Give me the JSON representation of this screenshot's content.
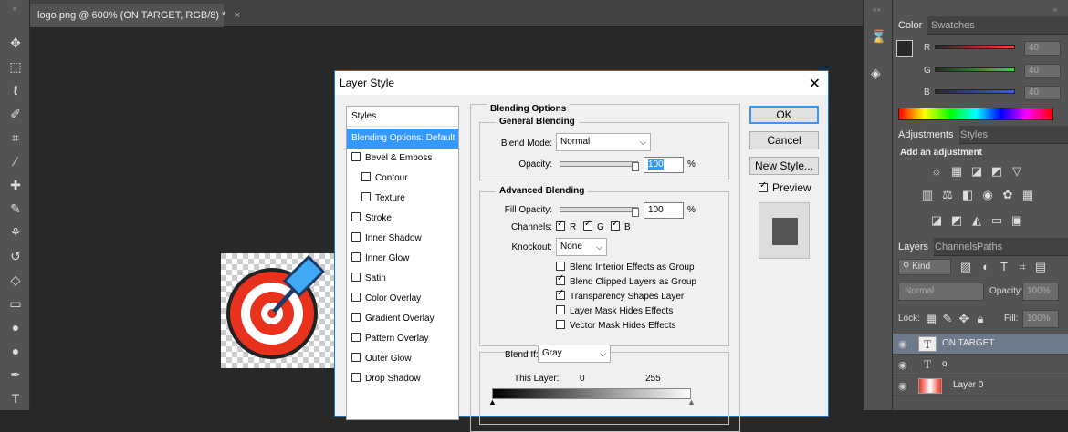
{
  "document_tab": {
    "title": "logo.png @ 600% (ON TARGET, RGB/8) *",
    "close": "×"
  },
  "toolbar": {
    "tools": [
      "move-tool-icon",
      "marquee-tool-icon",
      "lasso-tool-icon",
      "quick-select-tool-icon",
      "crop-tool-icon",
      "eyedropper-tool-icon",
      "healing-brush-tool-icon",
      "brush-tool-icon",
      "clone-stamp-tool-icon",
      "history-brush-tool-icon",
      "eraser-tool-icon",
      "gradient-tool-icon",
      "blur-tool-icon",
      "dodge-tool-icon",
      "pen-tool-icon",
      "type-tool-icon"
    ]
  },
  "color_panel": {
    "tabs": [
      "Color",
      "Swatches"
    ],
    "active_tab": "Color",
    "channels": [
      {
        "label": "R",
        "value": "40",
        "color": "#ff3b3b"
      },
      {
        "label": "G",
        "value": "40",
        "color": "#3bd83b"
      },
      {
        "label": "B",
        "value": "40",
        "color": "#3b5bff"
      }
    ]
  },
  "adjustments_panel": {
    "tabs": [
      "Adjustments",
      "Styles"
    ],
    "heading": "Add an adjustment"
  },
  "layers_panel": {
    "tabs": [
      "Layers",
      "Channels",
      "Paths"
    ],
    "kind_filter": "Kind",
    "blend_mode": "Normal",
    "opacity_label": "Opacity:",
    "opacity_value": "100%",
    "lock_label": "Lock:",
    "fill_label": "Fill:",
    "fill_value": "100%",
    "layers": [
      {
        "name": "ON TARGET",
        "thumb": "T",
        "selected": true
      },
      {
        "name": "o",
        "thumb": "T",
        "selected": false
      },
      {
        "name": "Layer 0",
        "thumb": "",
        "selected": false
      }
    ]
  },
  "dialog": {
    "title": "Layer Style",
    "close": "✕",
    "styles_header": "Styles",
    "styles": [
      {
        "label": "Blending Options: Default",
        "checkbox": false,
        "active": true,
        "indent": false
      },
      {
        "label": "Bevel & Emboss",
        "checkbox": true,
        "active": false,
        "indent": false
      },
      {
        "label": "Contour",
        "checkbox": true,
        "active": false,
        "indent": true
      },
      {
        "label": "Texture",
        "checkbox": true,
        "active": false,
        "indent": true
      },
      {
        "label": "Stroke",
        "checkbox": true,
        "active": false,
        "indent": false
      },
      {
        "label": "Inner Shadow",
        "checkbox": true,
        "active": false,
        "indent": false
      },
      {
        "label": "Inner Glow",
        "checkbox": true,
        "active": false,
        "indent": false
      },
      {
        "label": "Satin",
        "checkbox": true,
        "active": false,
        "indent": false
      },
      {
        "label": "Color Overlay",
        "checkbox": true,
        "active": false,
        "indent": false
      },
      {
        "label": "Gradient Overlay",
        "checkbox": true,
        "active": false,
        "indent": false
      },
      {
        "label": "Pattern Overlay",
        "checkbox": true,
        "active": false,
        "indent": false
      },
      {
        "label": "Outer Glow",
        "checkbox": true,
        "active": false,
        "indent": false
      },
      {
        "label": "Drop Shadow",
        "checkbox": true,
        "active": false,
        "indent": false
      }
    ],
    "blending_options": {
      "title": "Blending Options",
      "general_title": "General Blending",
      "blend_mode_label": "Blend Mode:",
      "blend_mode": "Normal",
      "opacity_label": "Opacity:",
      "opacity_value": "100",
      "percent": "%",
      "advanced_title": "Advanced Blending",
      "fill_opacity_label": "Fill Opacity:",
      "fill_opacity_value": "100",
      "channels_label": "Channels:",
      "channels": [
        {
          "label": "R",
          "checked": true
        },
        {
          "label": "G",
          "checked": true
        },
        {
          "label": "B",
          "checked": true
        }
      ],
      "knockout_label": "Knockout:",
      "knockout": "None",
      "options": [
        {
          "label": "Blend Interior Effects as Group",
          "checked": false
        },
        {
          "label": "Blend Clipped Layers as Group",
          "checked": true
        },
        {
          "label": "Transparency Shapes Layer",
          "checked": true
        },
        {
          "label": "Layer Mask Hides Effects",
          "checked": false
        },
        {
          "label": "Vector Mask Hides Effects",
          "checked": false
        }
      ],
      "blend_if_label": "Blend If:",
      "blend_if": "Gray",
      "this_layer_label": "This Layer:",
      "this_layer_min": "0",
      "this_layer_max": "255"
    },
    "buttons": {
      "ok": "OK",
      "cancel": "Cancel",
      "new_style": "New Style..."
    },
    "preview_label": "Preview",
    "preview_checked": true
  }
}
